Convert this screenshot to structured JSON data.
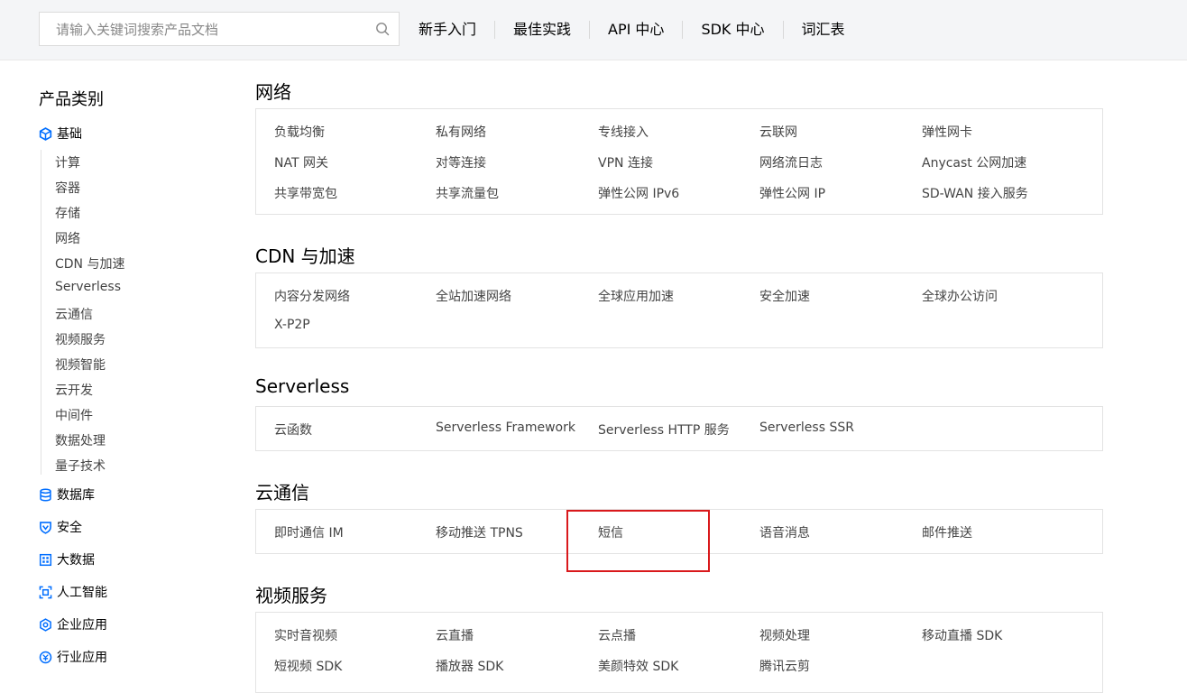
{
  "search": {
    "placeholder": "请输入关键词搜索产品文档",
    "icon": "search-icon"
  },
  "nav": [
    "新手入门",
    "最佳实践",
    "API 中心",
    "SDK 中心",
    "词汇表"
  ],
  "sidebar": {
    "title": "产品类别",
    "basic": {
      "label": "基础",
      "icon": "cube-icon",
      "items": [
        "计算",
        "容器",
        "存储",
        "网络",
        "CDN 与加速",
        "Serverless",
        "云通信",
        "视频服务",
        "视频智能",
        "云开发",
        "中间件",
        "数据处理",
        "量子技术"
      ]
    },
    "categories": [
      {
        "label": "数据库",
        "icon": "database-icon"
      },
      {
        "label": "安全",
        "icon": "shield-icon"
      },
      {
        "label": "大数据",
        "icon": "bigdata-icon"
      },
      {
        "label": "人工智能",
        "icon": "ai-icon"
      },
      {
        "label": "企业应用",
        "icon": "enterprise-icon"
      },
      {
        "label": "行业应用",
        "icon": "industry-icon"
      }
    ]
  },
  "sections": [
    {
      "title": "网络",
      "items": [
        "负载均衡",
        "私有网络",
        "专线接入",
        "云联网",
        "弹性网卡",
        "NAT 网关",
        "对等连接",
        "VPN 连接",
        "网络流日志",
        "Anycast 公网加速",
        "共享带宽包",
        "共享流量包",
        "弹性公网 IPv6",
        "弹性公网 IP",
        "SD-WAN 接入服务"
      ]
    },
    {
      "title": "CDN 与加速",
      "items": [
        "内容分发网络",
        "全站加速网络",
        "全球应用加速",
        "安全加速",
        "全球办公访问",
        "X-P2P"
      ]
    },
    {
      "title": "Serverless",
      "items": [
        "云函数",
        "Serverless Framework",
        "Serverless HTTP 服务",
        "Serverless SSR"
      ]
    },
    {
      "title": "云通信",
      "items": [
        "即时通信 IM",
        "移动推送 TPNS",
        "短信",
        "语音消息",
        "邮件推送"
      ]
    },
    {
      "title": "视频服务",
      "items": [
        "实时音视频",
        "云直播",
        "云点播",
        "视频处理",
        "移动直播 SDK",
        "短视频 SDK",
        "播放器 SDK",
        "美颜特效 SDK",
        "腾讯云剪"
      ]
    }
  ],
  "colors": {
    "accent": "#006eff",
    "highlight": "#d9191c"
  }
}
